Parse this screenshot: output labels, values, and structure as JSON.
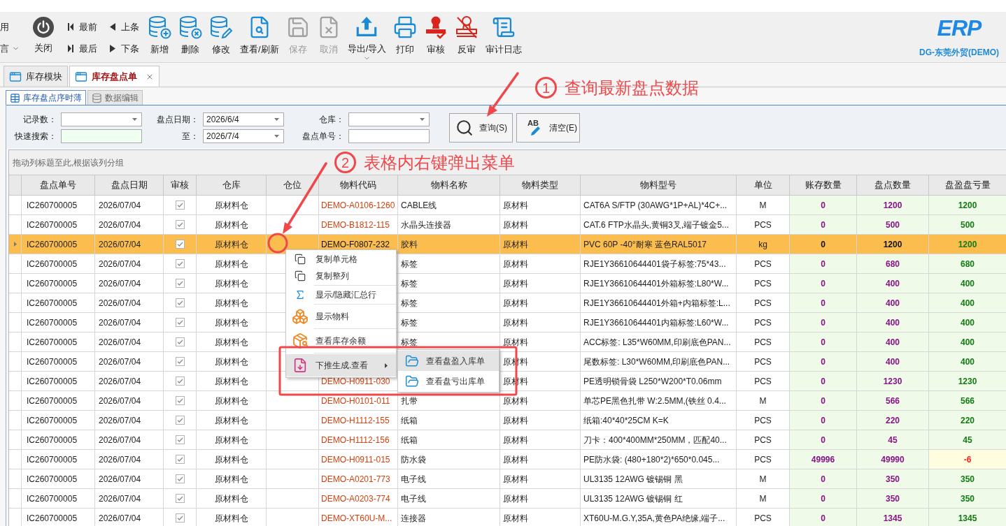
{
  "toolbar": {
    "cut_menus": [
      {
        "label": "用",
        "has_menu": false
      },
      {
        "label": "言",
        "has_menu": true
      }
    ],
    "close": {
      "label": "关闭"
    },
    "nav": [
      {
        "label": "最前"
      },
      {
        "label": "上条"
      },
      {
        "label": "最后"
      },
      {
        "label": "下条"
      }
    ],
    "buttons": [
      {
        "label": "新增",
        "disabled": false,
        "has_menu": false
      },
      {
        "label": "删除",
        "disabled": false,
        "has_menu": false
      },
      {
        "label": "修改",
        "disabled": false,
        "has_menu": false
      },
      {
        "label": "查看/刷新",
        "disabled": false,
        "has_menu": false
      },
      {
        "label": "保存",
        "disabled": true,
        "has_menu": false
      },
      {
        "label": "取消",
        "disabled": true,
        "has_menu": false
      },
      {
        "label": "导出/导入",
        "disabled": false,
        "has_menu": true
      },
      {
        "label": "打印",
        "disabled": false,
        "has_menu": false
      },
      {
        "label": "审核",
        "disabled": false,
        "has_menu": false
      },
      {
        "label": "反审",
        "disabled": false,
        "has_menu": false
      },
      {
        "label": "审计日志",
        "disabled": false,
        "has_menu": false
      }
    ]
  },
  "brand": {
    "logo": "ERP",
    "company": "DG-东莞外贸(DEMO)"
  },
  "tabs": [
    {
      "label": "库存模块",
      "selected": false,
      "closable": false
    },
    {
      "label": "库存盘点单",
      "selected": true,
      "closable": true
    }
  ],
  "sub_tabs": [
    {
      "label": "库存盘点序时薄",
      "selected": true
    },
    {
      "label": "数据编辑",
      "selected": false
    }
  ],
  "filters": [
    {
      "label": "记录数：",
      "kind": "dropdown"
    },
    {
      "label": "盘点日期：",
      "kind": "dropdown",
      "value": "2026/6/4"
    },
    {
      "label": "仓库：",
      "kind": "dropdown"
    },
    {
      "label": "快速搜索：",
      "kind": "search"
    },
    {
      "label": "至：",
      "kind": "dropdown",
      "value": "2026/7/4"
    },
    {
      "label": "盘点单号：",
      "kind": "text"
    }
  ],
  "filter_buttons": [
    {
      "label": "查询(S)"
    },
    {
      "label": "清空(E)",
      "icon_text": "AB"
    }
  ],
  "group_hint": "拖动列标题至此,根据该列分组",
  "table": {
    "columns": [
      "盘点单号",
      "盘点日期",
      "审核",
      "仓库",
      "仓位",
      "物料代码",
      "物料名称",
      "物料类型",
      "物料型号",
      "单位",
      "账存数量",
      "盘点数量",
      "盘盈盘亏量"
    ],
    "rows": [
      {
        "order_no": "IC260700005",
        "date": "2026/07/04",
        "approved": true,
        "warehouse": "原材料仓",
        "material_code": "DEMO-A0106-1260",
        "material_name": "CABLE线",
        "material_type": "原材料",
        "model": "CAT6A S/FTP (30AWG*1P+AL)*4C+...",
        "unit": "M",
        "book_qty": "0",
        "count_qty": "1200",
        "diff": "1200",
        "shortage": false,
        "selected": false
      },
      {
        "order_no": "IC260700005",
        "date": "2026/07/04",
        "approved": true,
        "warehouse": "原材料仓",
        "material_code": "DEMO-B1812-115",
        "material_name": "水晶头连接器",
        "material_type": "原材料",
        "model": "CAT.6 FTP水晶头,黄铜3叉,端子镀金5...",
        "unit": "PCS",
        "book_qty": "0",
        "count_qty": "500",
        "diff": "500",
        "shortage": false,
        "selected": false
      },
      {
        "order_no": "IC260700005",
        "date": "2026/07/04",
        "approved": true,
        "warehouse": "原材料仓",
        "material_code": "DEMO-F0807-232",
        "material_name": "胶料",
        "material_type": "原材料",
        "model": "PVC 60P -40°耐寒 蓝色RAL5017",
        "unit": "kg",
        "book_qty": "0",
        "count_qty": "1200",
        "diff": "1200",
        "shortage": false,
        "selected": true
      },
      {
        "order_no": "IC260700005",
        "date": "2026/07/04",
        "approved": true,
        "warehouse": "原材料仓",
        "material_name": "标签",
        "material_type": "原材料",
        "model": "RJE1Y36610644401袋子标签:75*43...",
        "unit": "PCS",
        "book_qty": "0",
        "count_qty": "680",
        "diff": "680",
        "shortage": false,
        "selected": false
      },
      {
        "order_no": "IC260700005",
        "date": "2026/07/04",
        "approved": true,
        "warehouse": "原材料仓",
        "material_name": "标签",
        "material_type": "原材料",
        "model": "RJE1Y36610644401外箱标签:L80*W...",
        "unit": "PCS",
        "book_qty": "0",
        "count_qty": "400",
        "diff": "400",
        "shortage": false,
        "selected": false
      },
      {
        "order_no": "IC260700005",
        "date": "2026/07/04",
        "approved": true,
        "warehouse": "原材料仓",
        "material_name": "标签",
        "material_type": "原材料",
        "model": "RJE1Y36610644401外箱+内箱标签:L...",
        "unit": "PCS",
        "book_qty": "0",
        "count_qty": "400",
        "diff": "400",
        "shortage": false,
        "selected": false
      },
      {
        "order_no": "IC260700005",
        "date": "2026/07/04",
        "approved": true,
        "warehouse": "原材料仓",
        "material_name": "标签",
        "material_type": "原材料",
        "model": "RJE1Y36610644401内箱标签:L60*W...",
        "unit": "PCS",
        "book_qty": "0",
        "count_qty": "400",
        "diff": "400",
        "shortage": false,
        "selected": false
      },
      {
        "order_no": "IC260700005",
        "date": "2026/07/04",
        "approved": true,
        "warehouse": "原材料仓",
        "material_name": "标签",
        "material_type": "原材料",
        "model": "ACC标签: L35*W60MM,印刷底色PAN...",
        "unit": "PCS",
        "book_qty": "0",
        "count_qty": "400",
        "diff": "400",
        "shortage": false,
        "selected": false
      },
      {
        "order_no": "IC260700005",
        "date": "2026/07/04",
        "approved": true,
        "warehouse": "原材料仓",
        "material_type": "原材料",
        "model": "尾数标签: L30*W60MM,印刷底色PAN...",
        "unit": "PCS",
        "book_qty": "0",
        "count_qty": "400",
        "diff": "400",
        "shortage": false,
        "selected": false
      },
      {
        "order_no": "IC260700005",
        "date": "2026/07/04",
        "approved": true,
        "warehouse": "原材料仓",
        "material_code": "DEMO-H0911-030",
        "material_type": "原材料",
        "model": "PE透明锁骨袋 L250*W200*T0.06mm",
        "unit": "PCS",
        "book_qty": "0",
        "count_qty": "1230",
        "diff": "1230",
        "shortage": false,
        "selected": false
      },
      {
        "order_no": "IC260700005",
        "date": "2026/07/04",
        "approved": true,
        "warehouse": "原材料仓",
        "material_code": "DEMO-H0101-011",
        "material_name": "扎带",
        "material_type": "原材料",
        "model": "单芯PE黑色扎带 W:2.5MM,(铁丝 0.4...",
        "unit": "M",
        "book_qty": "0",
        "count_qty": "566",
        "diff": "566",
        "shortage": false,
        "selected": false
      },
      {
        "order_no": "IC260700005",
        "date": "2026/07/04",
        "approved": true,
        "warehouse": "原材料仓",
        "material_code": "DEMO-H1112-155",
        "material_name": "纸箱",
        "material_type": "原材料",
        "model": "纸箱:40*40*25CM K=K",
        "unit": "PCS",
        "book_qty": "0",
        "count_qty": "220",
        "diff": "220",
        "shortage": false,
        "selected": false
      },
      {
        "order_no": "IC260700005",
        "date": "2026/07/04",
        "approved": true,
        "warehouse": "原材料仓",
        "material_code": "DEMO-H1112-156",
        "material_name": "纸箱",
        "material_type": "原材料",
        "model": "刀卡：400*400MM*250MM，匹配40...",
        "unit": "PCS",
        "book_qty": "0",
        "count_qty": "45",
        "diff": "45",
        "shortage": false,
        "selected": false
      },
      {
        "order_no": "IC260700005",
        "date": "2026/07/04",
        "approved": true,
        "warehouse": "原材料仓",
        "material_code": "DEMO-H0911-015",
        "material_name": "防水袋",
        "material_type": "原材料",
        "model": "PE防水袋: (480+180*2)*650*0.045...",
        "unit": "PCS",
        "book_qty": "49996",
        "count_qty": "49990",
        "diff": "-6",
        "shortage": true,
        "selected": false
      },
      {
        "order_no": "IC260700005",
        "date": "2026/07/04",
        "approved": true,
        "warehouse": "原材料仓",
        "material_code": "DEMO-A0201-773",
        "material_name": "电子线",
        "material_type": "原材料",
        "model": "UL3135 12AWG 镀锡铜 黑",
        "unit": "M",
        "book_qty": "0",
        "count_qty": "350",
        "diff": "350",
        "shortage": false,
        "selected": false
      },
      {
        "order_no": "IC260700005",
        "date": "2026/07/04",
        "approved": true,
        "warehouse": "原材料仓",
        "material_code": "DEMO-A0203-774",
        "material_name": "电子线",
        "material_type": "原材料",
        "model": "UL3135 12AWG 镀锡铜 红",
        "unit": "M",
        "book_qty": "0",
        "count_qty": "350",
        "diff": "350",
        "shortage": false,
        "selected": false
      },
      {
        "order_no": "IC260700005",
        "date": "2026/07/04",
        "approved": true,
        "warehouse": "原材料仓",
        "material_code": "DEMO-XT60U-M...",
        "material_name": "连接器",
        "material_type": "原材料",
        "model": "XT60U-M.G.Y,35A,黄色PA绝缘,端子...",
        "unit": "PCS",
        "book_qty": "0",
        "count_qty": "1345",
        "diff": "1345",
        "shortage": false,
        "selected": false
      }
    ]
  },
  "context_menu": {
    "groups": [
      [
        {
          "label": "复制单元格",
          "highlighted": false,
          "has_submenu": false
        },
        {
          "label": "复制整列",
          "highlighted": false,
          "has_submenu": false
        }
      ],
      [
        {
          "label": "显示/隐藏汇总行",
          "highlighted": false,
          "has_submenu": false
        }
      ],
      [
        {
          "label": "显示物料",
          "highlighted": false,
          "has_submenu": false
        }
      ],
      [
        {
          "label": "查看库存余额",
          "highlighted": false,
          "has_submenu": false
        }
      ],
      [
        {
          "label": "下推生成.查看",
          "highlighted": true,
          "has_submenu": true
        }
      ]
    ],
    "submenu": [
      {
        "label": "查看盘盈入库单",
        "highlighted": true
      },
      {
        "label": "查看盘亏出库单",
        "highlighted": false
      }
    ]
  },
  "annotations": [
    {
      "number": "1",
      "text": "查询最新盘点数据"
    },
    {
      "number": "2",
      "text": "表格内右键弹出菜单"
    }
  ]
}
